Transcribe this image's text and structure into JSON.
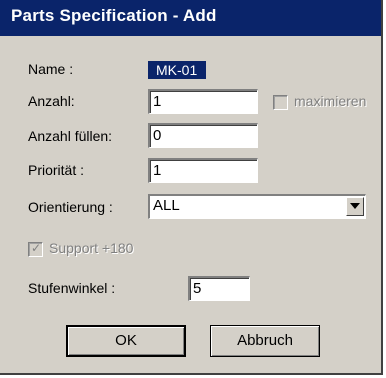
{
  "window": {
    "title": "Parts Specification - Add"
  },
  "form": {
    "name_label": "Name :",
    "name_value": "MK-01",
    "anzahl_label": "Anzahl:",
    "anzahl_value": "1",
    "maximieren_label": "maximieren",
    "maximieren_checked": false,
    "anzahl_fuellen_label": "Anzahl füllen:",
    "anzahl_fuellen_value": "0",
    "prioritaet_label": "Priorität :",
    "prioritaet_value": "1",
    "orientierung_label": "Orientierung :",
    "orientierung_value": "ALL",
    "support_label": "Support +180",
    "support_checked": true,
    "stufenwinkel_label": "Stufenwinkel :",
    "stufenwinkel_value": "5"
  },
  "buttons": {
    "ok_label": "OK",
    "cancel_label": "Abbruch"
  },
  "icons": {
    "dropdown": "chevron-down-icon",
    "check": "check-icon"
  }
}
